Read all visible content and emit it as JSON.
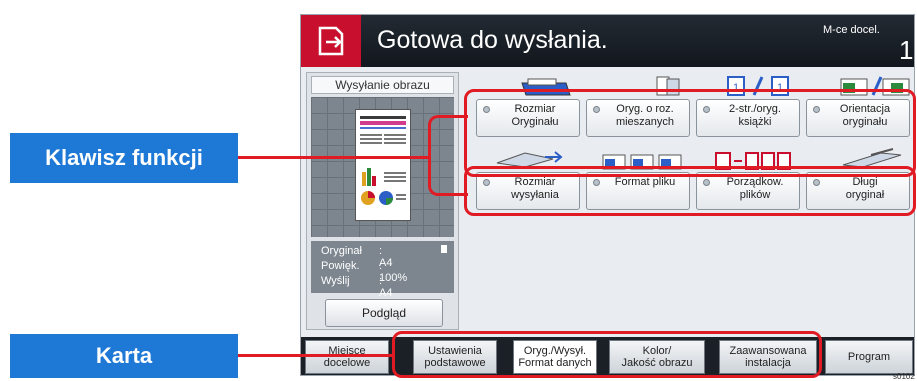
{
  "callouts": {
    "function_key": "Klawisz funkcji",
    "tab": "Karta"
  },
  "header": {
    "status": "Gotowa do wysłania.",
    "destinations_label": "M-ce docel.",
    "destinations_count": "1"
  },
  "preview": {
    "title": "Wysyłanie obrazu",
    "info": [
      {
        "label": "Oryginał",
        "value": ": A4"
      },
      {
        "label": "Powięk.",
        "value": ": 100%"
      },
      {
        "label": "Wyślij",
        "value": ": A4"
      }
    ],
    "button": "Podgląd"
  },
  "functions_row1": [
    {
      "line1": "Rozmiar",
      "line2": "Oryginału"
    },
    {
      "line1": "Oryg. o roz.",
      "line2": "mieszanych"
    },
    {
      "line1": "2-str./oryg.",
      "line2": "książki"
    },
    {
      "line1": "Orientacja",
      "line2": "oryginału"
    }
  ],
  "functions_row2": [
    {
      "line1": "Rozmiar",
      "line2": "wysyłania"
    },
    {
      "line1": "Format pliku",
      "line2": ""
    },
    {
      "line1": "Porządkow.",
      "line2": "plików"
    },
    {
      "line1": "Długi",
      "line2": "oryginał"
    }
  ],
  "tabs": [
    {
      "line1": "Miejsce",
      "line2": "docelowe"
    },
    {
      "line1": "Ustawienia",
      "line2": "podstawowe"
    },
    {
      "line1": "Oryg./Wysył.",
      "line2": "Format danych"
    },
    {
      "line1": "Kolor/",
      "line2": "Jakość obrazu"
    },
    {
      "line1": "Zaawansowana",
      "line2": "instalacja"
    },
    {
      "line1": "Program",
      "line2": ""
    }
  ],
  "figure_code": "s0102",
  "colors": {
    "callout_blue": "#1e78d6",
    "highlight_red": "#e01b24",
    "send_icon_red": "#c8102e",
    "title_bar": "#1a1f26"
  }
}
